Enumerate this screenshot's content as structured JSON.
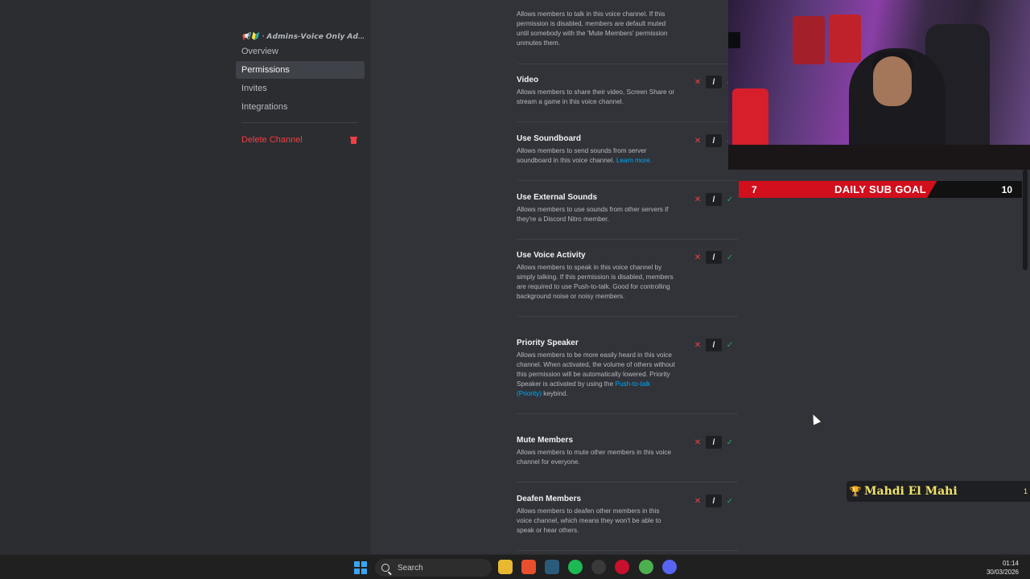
{
  "sidebar": {
    "channel_header": "📢🔰 · 𝘼𝙙𝙢𝙞𝙣𝙨-𝙑𝙤𝙞𝙘𝙚 𝙊𝙣𝙡𝙮 𝘼𝙙...",
    "items": [
      {
        "label": "Overview"
      },
      {
        "label": "Permissions"
      },
      {
        "label": "Invites"
      },
      {
        "label": "Integrations"
      }
    ],
    "delete_label": "Delete Channel"
  },
  "permissions": [
    {
      "title": "",
      "desc": "Allows members to talk in this voice channel. If this permission is disabled, members are default muted until somebody with the 'Mute Members' permission unmutes them.",
      "link": ""
    },
    {
      "title": "Video",
      "desc": "Allows members to share their video, Screen Share or stream a game in this voice channel.",
      "link": ""
    },
    {
      "title": "Use Soundboard",
      "desc": "Allows members to send sounds from server soundboard in this voice channel.",
      "link": "Learn more."
    },
    {
      "title": "Use External Sounds",
      "desc": "Allows members to use sounds from other servers if they're a Discord Nitro member.",
      "link": ""
    },
    {
      "title": "Use Voice Activity",
      "desc": "Allows members to speak in this voice channel by simply talking. If this permission is disabled, members are required to use Push-to-talk. Good for controlling background noise or noisy members.",
      "link": ""
    },
    {
      "title": "Priority Speaker",
      "desc": "Allows members to be more easily heard in this voice channel. When activated, the volume of others without this permission will be automatically lowered. Priority Speaker is activated by using the",
      "link": "Push-to-talk (Priority)",
      "after": "keybind."
    },
    {
      "title": "Mute Members",
      "desc": "Allows members to mute other members in this voice channel for everyone.",
      "link": ""
    },
    {
      "title": "Deafen Members",
      "desc": "Allows members to deafen other members in this voice channel, which means they won't be able to speak or hear others.",
      "link": ""
    }
  ],
  "toggle_glyphs": {
    "deny": "✕",
    "neutral": "/",
    "allow": "✓"
  },
  "sub_goal": {
    "current": "7",
    "label": "DAILY SUB GOAL",
    "target": "10",
    "progress": 0.7
  },
  "alert": {
    "name": "Mahdi El Mahi",
    "count": "1"
  },
  "taskbar": {
    "search_placeholder": "Search",
    "time": "01:14",
    "date": "30/03/2026"
  },
  "colors": {
    "accent_red": "#f23f43",
    "allow_green": "#23a55a",
    "link_blue": "#00a8fc",
    "goal_red": "#d10f1d"
  }
}
